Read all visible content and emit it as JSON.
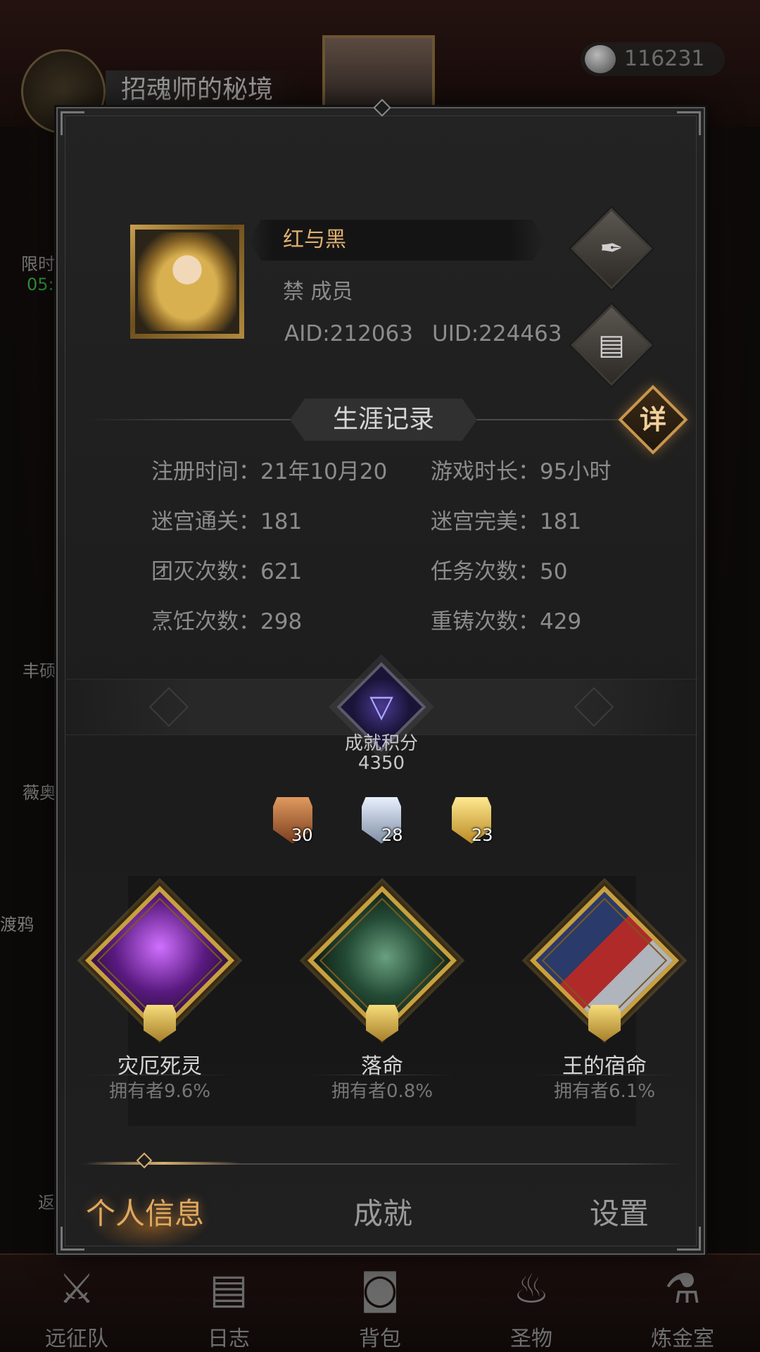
{
  "background": {
    "realm_title": "招魂师的秘境",
    "currency_amount": "116231",
    "side_labels": [
      "限时",
      "05:",
      "丰硕",
      "薇奥",
      "渡鸦",
      "返"
    ],
    "bottom_nav": [
      {
        "label": "远征队",
        "icon": "viking-helmet-icon"
      },
      {
        "label": "日志",
        "icon": "scroll-icon"
      },
      {
        "label": "背包",
        "icon": "backpack-icon"
      },
      {
        "label": "圣物",
        "icon": "torch-icon"
      },
      {
        "label": "炼金室",
        "icon": "alchemy-icon"
      }
    ]
  },
  "profile": {
    "name": "红与黑",
    "guild": "禁 成员",
    "aid": "AID:212063",
    "uid": "UID:224463",
    "edit_icon": "quill-icon",
    "copy_icon": "scroll-copy-icon"
  },
  "career": {
    "title": "生涯记录",
    "detail_label": "详",
    "stats": [
      {
        "label": "注册时间：",
        "value": "21年10月20"
      },
      {
        "label": "游戏时长：",
        "value": "95小时"
      },
      {
        "label": "迷宫通关：",
        "value": "181"
      },
      {
        "label": "迷宫完美：",
        "value": "181"
      },
      {
        "label": "团灭次数：",
        "value": "621"
      },
      {
        "label": "任务次数：",
        "value": "50"
      },
      {
        "label": "烹饪次数：",
        "value": "298"
      },
      {
        "label": "重铸次数：",
        "value": "429"
      }
    ]
  },
  "achievement_score": {
    "label": "成就积分",
    "value": "4350",
    "medals": [
      {
        "tier": "bronze",
        "count": "30",
        "color": "#c07a45"
      },
      {
        "tier": "silver",
        "count": "28",
        "color": "#b9c7d6"
      },
      {
        "tier": "gold",
        "count": "23",
        "color": "#e8c050"
      }
    ]
  },
  "showcase": [
    {
      "name": "灾厄死灵",
      "owners": "拥有者9.6%",
      "theme_color": "#8a3cc0"
    },
    {
      "name": "落命",
      "owners": "拥有者0.8%",
      "theme_color": "#2f6a4a"
    },
    {
      "name": "王的宿命",
      "owners": "拥有者6.1%",
      "theme_color": "#b02a2a"
    }
  ],
  "tabs": [
    {
      "label": "个人信息",
      "active": true
    },
    {
      "label": "成就",
      "active": false
    },
    {
      "label": "设置",
      "active": false
    }
  ]
}
